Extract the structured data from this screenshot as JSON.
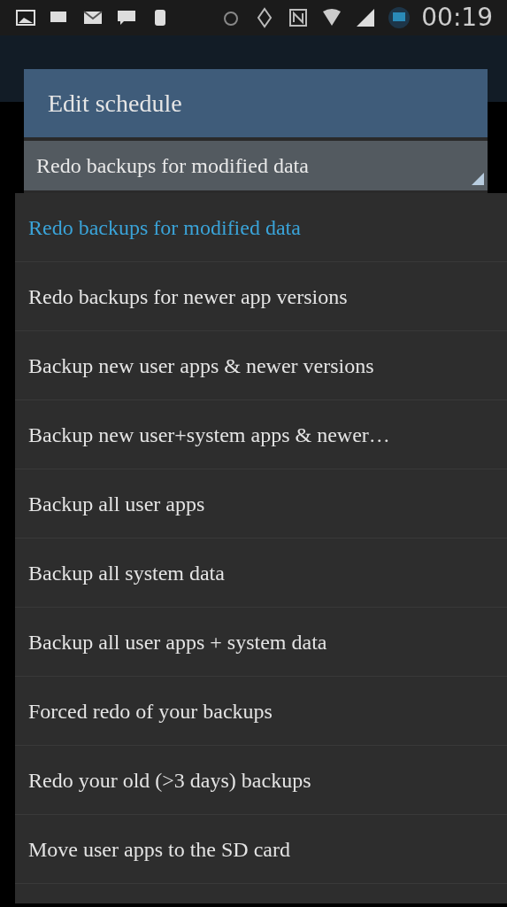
{
  "status_bar": {
    "time": "00:19"
  },
  "dialog": {
    "title": "Edit schedule",
    "spinner": {
      "value": "Redo backups for modified data"
    }
  },
  "dropdown": {
    "options": [
      {
        "label": "Redo backups for modified data",
        "selected": true
      },
      {
        "label": "Redo backups for newer app versions",
        "selected": false
      },
      {
        "label": "Backup new user apps & newer versions",
        "selected": false
      },
      {
        "label": "Backup new user+system apps & newer…",
        "selected": false
      },
      {
        "label": "Backup all user apps",
        "selected": false
      },
      {
        "label": "Backup all system data",
        "selected": false
      },
      {
        "label": "Backup all user apps + system data",
        "selected": false
      },
      {
        "label": "Forced redo of your backups",
        "selected": false
      },
      {
        "label": "Redo your old (>3 days) backups",
        "selected": false
      },
      {
        "label": "Move user apps to the SD card",
        "selected": false
      }
    ]
  }
}
